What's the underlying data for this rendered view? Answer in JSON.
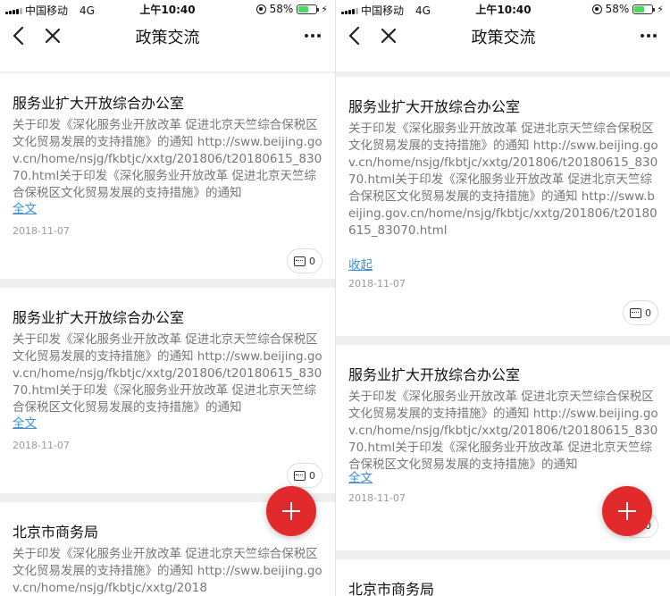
{
  "status": {
    "carrier": "中国移动",
    "network": "4G",
    "time": "上午10:40",
    "battery": "58%"
  },
  "nav": {
    "title": "政策交流"
  },
  "left_cards": [
    {
      "org": "服务业扩大开放综合办公室",
      "body": "关于印发《深化服务业开放改革 促进北京天竺综合保税区文化贸易发展的支持措施》的通知 http://sww.beijing.gov.cn/home/nsjg/fkbtjc/xxtg/201806/t20180615_83070.html关于印发《深化服务业开放改革 促进北京天竺综合保税区文化贸易发展的支持措施》的通知",
      "toggle": "全文",
      "date": "2018-11-07",
      "comments": "0"
    },
    {
      "org": "服务业扩大开放综合办公室",
      "body": "关于印发《深化服务业开放改革 促进北京天竺综合保税区文化贸易发展的支持措施》的通知 http://sww.beijing.gov.cn/home/nsjg/fkbtjc/xxtg/201806/t20180615_83070.html关于印发《深化服务业开放改革 促进北京天竺综合保税区文化贸易发展的支持措施》的通知",
      "toggle": "全文",
      "date": "2018-11-07",
      "comments": "0"
    },
    {
      "org": "北京市商务局",
      "body": "关于印发《深化服务业开放改革 促进北京天竺综合保税区文化贸易发展的支持措施》的通知 http://sww.beijing.gov.cn/home/nsjg/fkbtjc/xxtg/2018"
    }
  ],
  "right_cards": [
    {
      "org": "服务业扩大开放综合办公室",
      "body": "关于印发《深化服务业开放改革 促进北京天竺综合保税区文化贸易发展的支持措施》的通知 http://sww.beijing.gov.cn/home/nsjg/fkbtjc/xxtg/201806/t20180615_83070.html关于印发《深化服务业开放改革 促进北京天竺综合保税区文化贸易发展的支持措施》的通知 http://sww.beijing.gov.cn/home/nsjg/fkbtjc/xxtg/201806/t20180615_83070.html",
      "toggle": "收起",
      "date": "2018-11-07",
      "comments": "0"
    },
    {
      "org": "服务业扩大开放综合办公室",
      "body": "关于印发《深化服务业开放改革 促进北京天竺综合保税区文化贸易发展的支持措施》的通知 http://sww.beijing.gov.cn/home/nsjg/fkbtjc/xxtg/201806/t20180615_83070.html关于印发《深化服务业开放改革 促进北京天竺综合保税区文化贸易发展的支持措施》的通知",
      "toggle": "全文",
      "date": "2018-11-07",
      "comments": "0"
    },
    {
      "org": "北京市商务局"
    }
  ],
  "icons": {
    "back": "chevron-left-icon",
    "close": "close-icon",
    "more": "more-dots-icon",
    "comment": "comment-icon",
    "add": "plus-icon"
  },
  "colors": {
    "fab": "#e22a2d",
    "link": "#3b8ed8",
    "battery": "#4cd964"
  }
}
